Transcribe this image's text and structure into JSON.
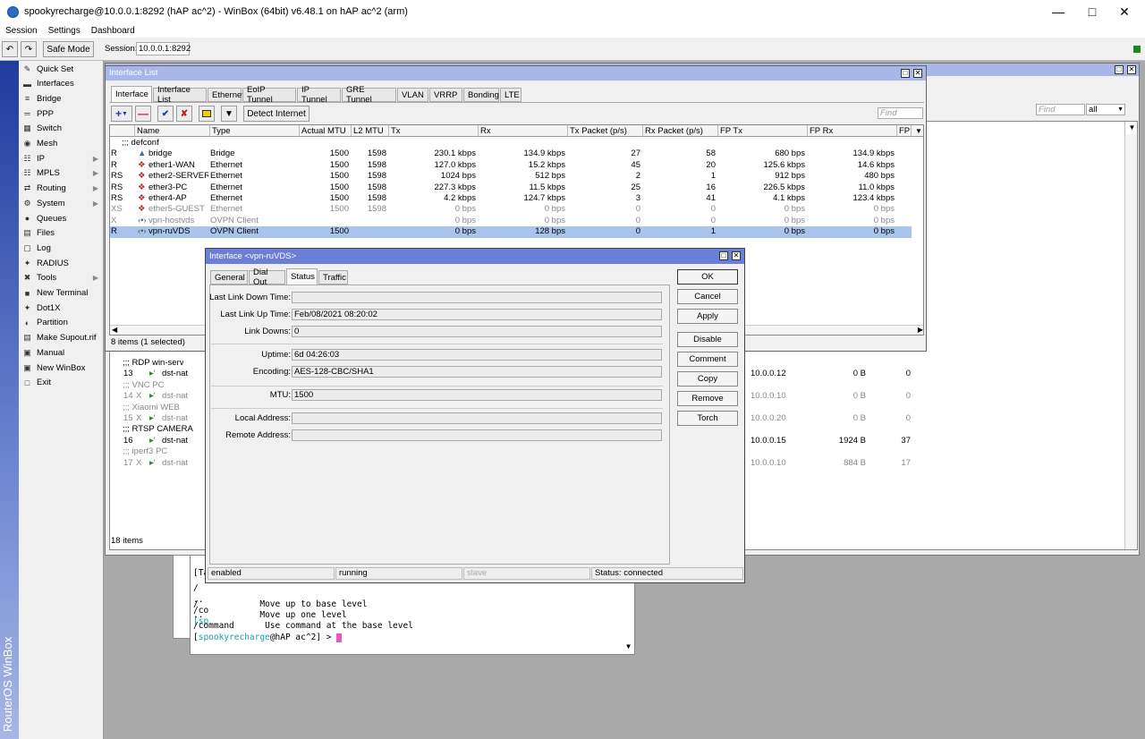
{
  "app": {
    "title": "spookyrecharge@10.0.0.1:8292 (hAP ac^2) - WinBox (64bit) v6.48.1 on hAP ac^2 (arm)",
    "brand": "RouterOS WinBox"
  },
  "menu": [
    "Session",
    "Settings",
    "Dashboard"
  ],
  "toolbar": {
    "safe_mode": "Safe Mode",
    "session_label": "Session:",
    "session_value": "10.0.0.1:8292"
  },
  "sidebar": [
    {
      "label": "Quick Set",
      "icon": "quickset-icon",
      "arrow": false
    },
    {
      "label": "Interfaces",
      "icon": "interfaces-icon",
      "arrow": false
    },
    {
      "label": "Bridge",
      "icon": "bridge-icon",
      "arrow": false
    },
    {
      "label": "PPP",
      "icon": "ppp-icon",
      "arrow": false
    },
    {
      "label": "Switch",
      "icon": "switch-icon",
      "arrow": false
    },
    {
      "label": "Mesh",
      "icon": "mesh-icon",
      "arrow": false
    },
    {
      "label": "IP",
      "icon": "ip-icon",
      "arrow": true
    },
    {
      "label": "MPLS",
      "icon": "mpls-icon",
      "arrow": true
    },
    {
      "label": "Routing",
      "icon": "routing-icon",
      "arrow": true
    },
    {
      "label": "System",
      "icon": "system-icon",
      "arrow": true
    },
    {
      "label": "Queues",
      "icon": "queues-icon",
      "arrow": false
    },
    {
      "label": "Files",
      "icon": "files-icon",
      "arrow": false
    },
    {
      "label": "Log",
      "icon": "log-icon",
      "arrow": false
    },
    {
      "label": "RADIUS",
      "icon": "radius-icon",
      "arrow": false
    },
    {
      "label": "Tools",
      "icon": "tools-icon",
      "arrow": true
    },
    {
      "label": "New Terminal",
      "icon": "terminal-icon",
      "arrow": false
    },
    {
      "label": "Dot1X",
      "icon": "dot1x-icon",
      "arrow": false
    },
    {
      "label": "Partition",
      "icon": "partition-icon",
      "arrow": false
    },
    {
      "label": "Make Supout.rif",
      "icon": "supout-icon",
      "arrow": false
    },
    {
      "label": "Manual",
      "icon": "manual-icon",
      "arrow": false
    },
    {
      "label": "New WinBox",
      "icon": "winbox-icon",
      "arrow": false
    },
    {
      "label": "Exit",
      "icon": "exit-icon",
      "arrow": false
    }
  ],
  "bgwin": {
    "find_placeholder": "Find",
    "filter_value": "all",
    "count": "18 items",
    "rows": [
      {
        "text": ";;; RDP win-serv",
        "dis": false,
        "comment": true
      },
      {
        "text": "13",
        "flag": "",
        "action": "dst-nat",
        "addr": "10.0.0.12",
        "bytes": "0 B",
        "pk": "0",
        "dis": false
      },
      {
        "text": ";;; VNC PC",
        "dis": true,
        "comment": true
      },
      {
        "text": "14",
        "flag": "X",
        "action": "dst-nat",
        "addr": "10.0.0.10",
        "bytes": "0 B",
        "pk": "0",
        "dis": true
      },
      {
        "text": ";;; Xiaomi WEB",
        "dis": true,
        "comment": true
      },
      {
        "text": "15",
        "flag": "X",
        "action": "dst-nat",
        "addr": "10.0.0.20",
        "bytes": "0 B",
        "pk": "0",
        "dis": true
      },
      {
        "text": ";;; RTSP CAMERA",
        "dis": false,
        "comment": true
      },
      {
        "text": "16",
        "flag": "",
        "action": "dst-nat",
        "addr": "10.0.0.15",
        "bytes": "1924 B",
        "pk": "37",
        "dis": false
      },
      {
        "text": ";;; iperf3 PC",
        "dis": true,
        "comment": true
      },
      {
        "text": "17",
        "flag": "X",
        "action": "dst-nat",
        "addr": "10.0.0.10",
        "bytes": "884 B",
        "pk": "17",
        "dis": true
      }
    ]
  },
  "iflist": {
    "title": "Interface List",
    "tabs": [
      "Interface",
      "Interface List",
      "Ethernet",
      "EoIP Tunnel",
      "IP Tunnel",
      "GRE Tunnel",
      "VLAN",
      "VRRP",
      "Bonding",
      "LTE"
    ],
    "detect_internet": "Detect Internet",
    "find_placeholder": "Find",
    "columns": [
      "Name",
      "Type",
      "Actual MTU",
      "L2 MTU",
      "Tx",
      "Rx",
      "Tx Packet (p/s)",
      "Rx Packet (p/s)",
      "FP Tx",
      "FP Rx",
      "FP"
    ],
    "comment": ";;; defconf",
    "rows": [
      {
        "flag": "R",
        "name": "bridge",
        "type": "Bridge",
        "mtu": "1500",
        "l2": "1598",
        "tx": "230.1 kbps",
        "rx": "134.9 kbps",
        "txp": "27",
        "rxp": "58",
        "fptx": "680 bps",
        "fprx": "134.9 kbps",
        "dis": false,
        "sel": false
      },
      {
        "flag": "R",
        "name": "ether1-WAN",
        "type": "Ethernet",
        "mtu": "1500",
        "l2": "1598",
        "tx": "127.0 kbps",
        "rx": "15.2 kbps",
        "txp": "45",
        "rxp": "20",
        "fptx": "125.6 kbps",
        "fprx": "14.6 kbps",
        "dis": false,
        "sel": false
      },
      {
        "flag": "RS",
        "name": "ether2-SERVER",
        "type": "Ethernet",
        "mtu": "1500",
        "l2": "1598",
        "tx": "1024 bps",
        "rx": "512 bps",
        "txp": "2",
        "rxp": "1",
        "fptx": "912 bps",
        "fprx": "480 bps",
        "dis": false,
        "sel": false
      },
      {
        "flag": "RS",
        "name": "ether3-PC",
        "type": "Ethernet",
        "mtu": "1500",
        "l2": "1598",
        "tx": "227.3 kbps",
        "rx": "11.5 kbps",
        "txp": "25",
        "rxp": "16",
        "fptx": "226.5 kbps",
        "fprx": "11.0 kbps",
        "dis": false,
        "sel": false
      },
      {
        "flag": "RS",
        "name": "ether4-AP",
        "type": "Ethernet",
        "mtu": "1500",
        "l2": "1598",
        "tx": "4.2 kbps",
        "rx": "124.7 kbps",
        "txp": "3",
        "rxp": "41",
        "fptx": "4.1 kbps",
        "fprx": "123.4 kbps",
        "dis": false,
        "sel": false
      },
      {
        "flag": "XS",
        "name": "ether5-GUEST",
        "type": "Ethernet",
        "mtu": "1500",
        "l2": "1598",
        "tx": "0 bps",
        "rx": "0 bps",
        "txp": "0",
        "rxp": "0",
        "fptx": "0 bps",
        "fprx": "0 bps",
        "dis": true,
        "sel": false
      },
      {
        "flag": "X",
        "name": "vpn-hostvds",
        "type": "OVPN Client",
        "mtu": "",
        "l2": "",
        "tx": "0 bps",
        "rx": "0 bps",
        "txp": "0",
        "rxp": "0",
        "fptx": "0 bps",
        "fprx": "0 bps",
        "dis": true,
        "sel": false
      },
      {
        "flag": "R",
        "name": "vpn-ruVDS",
        "type": "OVPN Client",
        "mtu": "1500",
        "l2": "",
        "tx": "0 bps",
        "rx": "128 bps",
        "txp": "0",
        "rxp": "1",
        "fptx": "0 bps",
        "fprx": "0 bps",
        "dis": false,
        "sel": true
      }
    ],
    "status": "8 items (1 selected)"
  },
  "dialog": {
    "title": "Interface <vpn-ruVDS>",
    "tabs": [
      "General",
      "Dial Out",
      "Status",
      "Traffic"
    ],
    "fields": [
      {
        "label": "Last Link Down Time:",
        "value": ""
      },
      {
        "label": "Last Link Up Time:",
        "value": "Feb/08/2021 08:20:02"
      },
      {
        "label": "Link Downs:",
        "value": "0"
      },
      {
        "label": "Uptime:",
        "value": "6d 04:26:03"
      },
      {
        "label": "Encoding:",
        "value": "AES-128-CBC/SHA1"
      },
      {
        "label": "MTU:",
        "value": "1500"
      },
      {
        "label": "Local Address:",
        "value": ""
      },
      {
        "label": "Remote Address:",
        "value": ""
      }
    ],
    "buttons": [
      "OK",
      "Cancel",
      "Apply",
      "Disable",
      "Comment",
      "Copy",
      "Remove",
      "Torch"
    ],
    "status": [
      "enabled",
      "running",
      "slave",
      "Status: connected"
    ]
  },
  "terminal": {
    "lines": [
      "[Ta",
      "/",
      "..",
      "/co",
      "[sp",
      "/            Move up to base level",
      "..           Move up one level",
      "/command      Use command at the base level"
    ],
    "prompt_user": "spookyrecharge",
    "prompt_host": "@hAP ac^2] > ",
    "prompt_open": "["
  },
  "colors": {
    "accent": "#2b6cc4",
    "title_active": "#6b7fd6",
    "title_inactive": "#a8b6e8",
    "selection": "#a9c4ec"
  }
}
